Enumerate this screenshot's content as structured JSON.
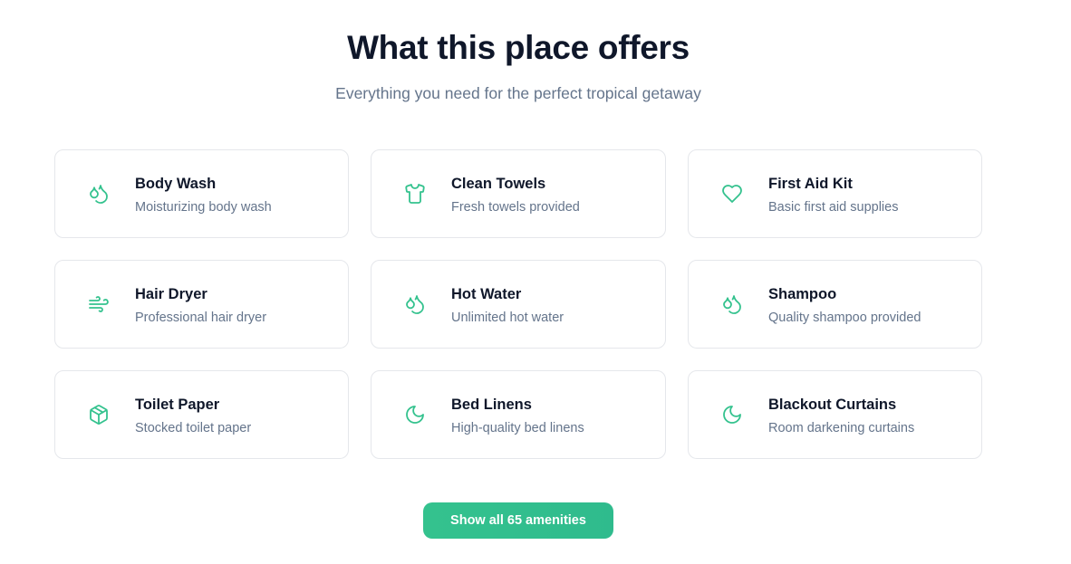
{
  "header": {
    "title": "What this place offers",
    "subtitle": "Everything you need for the perfect tropical getaway"
  },
  "theme": {
    "accent": "#34c28e",
    "title_color": "#0f172a",
    "muted_color": "#64748b",
    "border_color": "#e5e7eb"
  },
  "amenities": [
    {
      "name": "Body Wash",
      "description": "Moisturizing body wash",
      "icon": "droplets-icon"
    },
    {
      "name": "Clean Towels",
      "description": "Fresh towels provided",
      "icon": "shirt-icon"
    },
    {
      "name": "First Aid Kit",
      "description": "Basic first aid supplies",
      "icon": "heart-icon"
    },
    {
      "name": "Hair Dryer",
      "description": "Professional hair dryer",
      "icon": "wind-icon"
    },
    {
      "name": "Hot Water",
      "description": "Unlimited hot water",
      "icon": "droplets-icon"
    },
    {
      "name": "Shampoo",
      "description": "Quality shampoo provided",
      "icon": "droplets-icon"
    },
    {
      "name": "Toilet Paper",
      "description": "Stocked toilet paper",
      "icon": "package-icon"
    },
    {
      "name": "Bed Linens",
      "description": "High-quality bed linens",
      "icon": "moon-icon"
    },
    {
      "name": "Blackout Curtains",
      "description": "Room darkening curtains",
      "icon": "moon-icon"
    }
  ],
  "show_all_button": {
    "label": "Show all 65 amenities"
  }
}
